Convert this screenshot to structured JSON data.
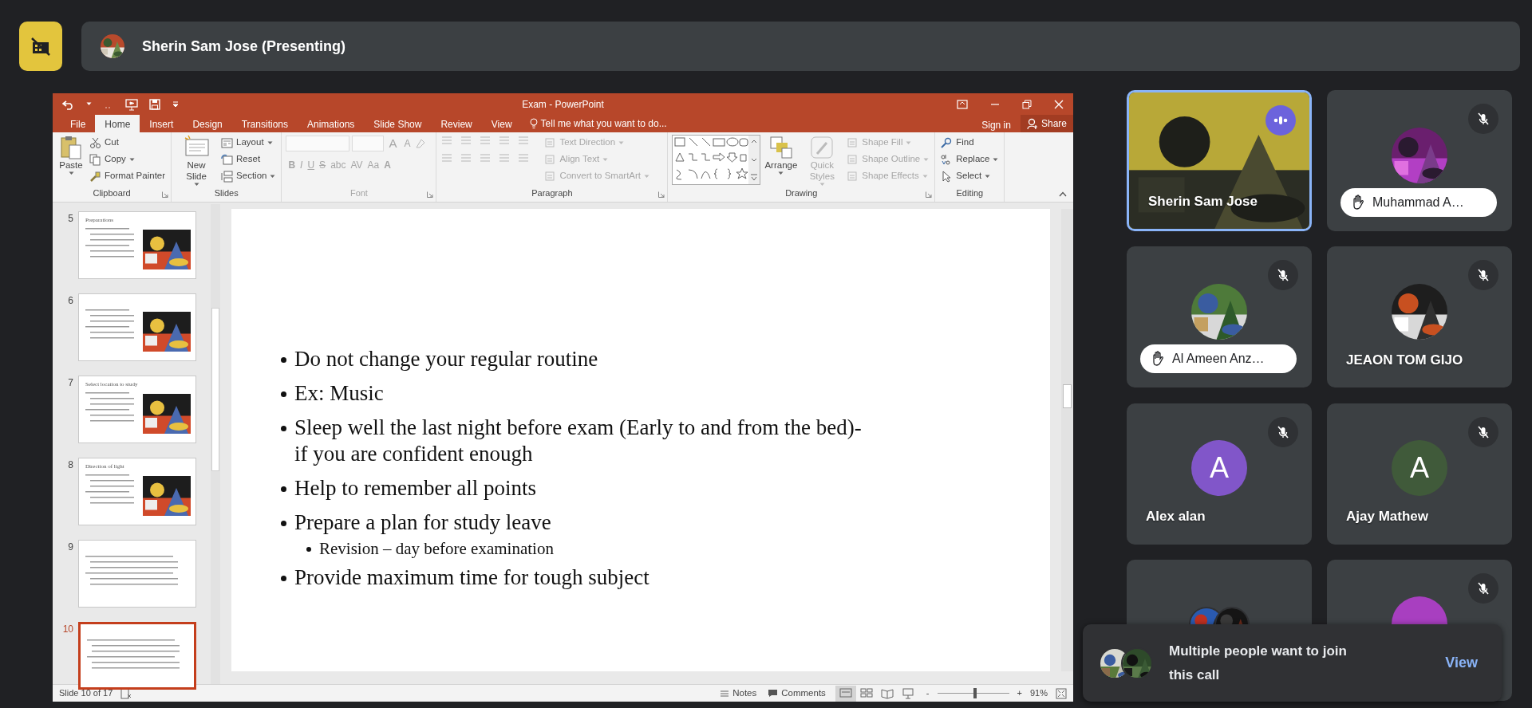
{
  "meet_header": {
    "presenter": "Sherin Sam Jose (Presenting)"
  },
  "powerpoint": {
    "title": "Exam - PowerPoint",
    "tabs": [
      {
        "label": "File",
        "selected": false
      },
      {
        "label": "Home",
        "selected": true
      },
      {
        "label": "Insert",
        "selected": false
      },
      {
        "label": "Design",
        "selected": false
      },
      {
        "label": "Transitions",
        "selected": false
      },
      {
        "label": "Animations",
        "selected": false
      },
      {
        "label": "Slide Show",
        "selected": false
      },
      {
        "label": "Review",
        "selected": false
      },
      {
        "label": "View",
        "selected": false
      }
    ],
    "tell_me": "Tell me what you want to do...",
    "sign_in": "Sign in",
    "share": "Share",
    "ribbon": [
      {
        "kind": "clipboard",
        "label": "Clipboard",
        "large": [
          {
            "label": "Paste",
            "disabled": false,
            "menu": true
          }
        ],
        "small": [
          {
            "label": "Cut",
            "disabled": false,
            "menu": false
          },
          {
            "label": "Copy",
            "disabled": false,
            "menu": true
          },
          {
            "label": "Format Painter",
            "disabled": false,
            "menu": false
          }
        ]
      },
      {
        "kind": "slides",
        "label": "Slides",
        "large": [
          {
            "label": "New Slide",
            "disabled": false,
            "menu": true
          }
        ],
        "small": [
          {
            "label": "Layout",
            "disabled": false,
            "menu": true
          },
          {
            "label": "Reset",
            "disabled": false,
            "menu": false
          },
          {
            "label": "Section",
            "disabled": false,
            "menu": true
          }
        ]
      },
      {
        "kind": "font",
        "label": "Font",
        "disabled": true,
        "size_glyphs": [
          "A",
          "A"
        ],
        "glyphs": [
          "B",
          "I",
          "U",
          "S",
          "abc",
          "AV",
          "Aa",
          "A"
        ]
      },
      {
        "kind": "paragraph",
        "label": "Paragraph",
        "small": [
          {
            "label": "Text Direction",
            "disabled": true,
            "menu": true
          },
          {
            "label": "Align Text",
            "disabled": true,
            "menu": true
          },
          {
            "label": "Convert to SmartArt",
            "disabled": true,
            "menu": true
          }
        ]
      },
      {
        "kind": "drawing",
        "label": "Drawing",
        "large": [
          {
            "label": "Arrange",
            "disabled": false,
            "menu": true
          },
          {
            "label": "Quick Styles",
            "disabled": true,
            "menu": true
          }
        ],
        "small": [
          {
            "label": "Shape Fill",
            "disabled": true,
            "menu": true
          },
          {
            "label": "Shape Outline",
            "disabled": true,
            "menu": true
          },
          {
            "label": "Shape Effects",
            "disabled": true,
            "menu": true
          }
        ]
      },
      {
        "kind": "editing",
        "label": "Editing",
        "small": [
          {
            "label": "Find",
            "disabled": false,
            "menu": false
          },
          {
            "label": "Replace",
            "disabled": false,
            "menu": true
          },
          {
            "label": "Select",
            "disabled": false,
            "menu": true
          }
        ]
      }
    ],
    "thumbnails": [
      {
        "number": "5",
        "selected": false,
        "title": "Preparations",
        "has_picture": true
      },
      {
        "number": "6",
        "selected": false,
        "has_picture": true
      },
      {
        "number": "7",
        "selected": false,
        "title": "Select location to study",
        "has_picture": true
      },
      {
        "number": "8",
        "selected": false,
        "title": "Direction of light",
        "has_picture": true
      },
      {
        "number": "9",
        "selected": false,
        "has_picture": false
      },
      {
        "number": "10",
        "selected": true,
        "has_picture": false
      }
    ],
    "slide": {
      "bullets": [
        {
          "text": "Do not change your regular routine"
        },
        {
          "text": "Ex: Music"
        },
        {
          "text": "Sleep well the last night before exam (Early to and from the bed)- if you are confident enough"
        },
        {
          "text": "Help to remember all points"
        },
        {
          "text": "Prepare a plan for study leave",
          "children": [
            {
              "text": "Revision – day before examination"
            }
          ]
        },
        {
          "text": "Provide maximum time for tough subject"
        }
      ]
    },
    "status": {
      "slide_counter": "Slide 10 of 17",
      "notes": "Notes",
      "comments": "Comments",
      "views": [
        {
          "selected": true
        },
        {
          "selected": false
        },
        {
          "selected": false
        },
        {
          "selected": false
        }
      ],
      "zoom_out": "-",
      "zoom_in": "+",
      "zoom": {
        "level": 0.5,
        "reading": "91%"
      }
    }
  },
  "participants": [
    {
      "name": "Sherin Sam Jose",
      "kind": "video",
      "speaking": true,
      "muted": false,
      "hand_raised": false
    },
    {
      "name": "Muhammad A…",
      "speaking": false,
      "muted": true,
      "hand_raised": true
    },
    {
      "name": "Al Ameen Anz…",
      "speaking": false,
      "muted": true,
      "hand_raised": true
    },
    {
      "name": "JEAON TOM GIJO",
      "speaking": false,
      "muted": true,
      "hand_raised": false
    },
    {
      "name": "Alex alan",
      "kind": "letter",
      "letter": "A",
      "color": "#8156c9",
      "speaking": false,
      "muted": true,
      "hand_raised": false
    },
    {
      "name": "Ajay Mathew",
      "kind": "letter",
      "letter": "A",
      "color": "#405a3a",
      "speaking": false,
      "muted": true,
      "hand_raised": false
    },
    {
      "kind": "photos",
      "speaking": false,
      "muted": false,
      "hand_raised": false
    },
    {
      "kind": "letter",
      "color": "#a83fc0",
      "speaking": false,
      "muted": true,
      "hand_raised": false
    }
  ],
  "join_request": {
    "message": "Multiple people want to join this call",
    "action": "View"
  }
}
